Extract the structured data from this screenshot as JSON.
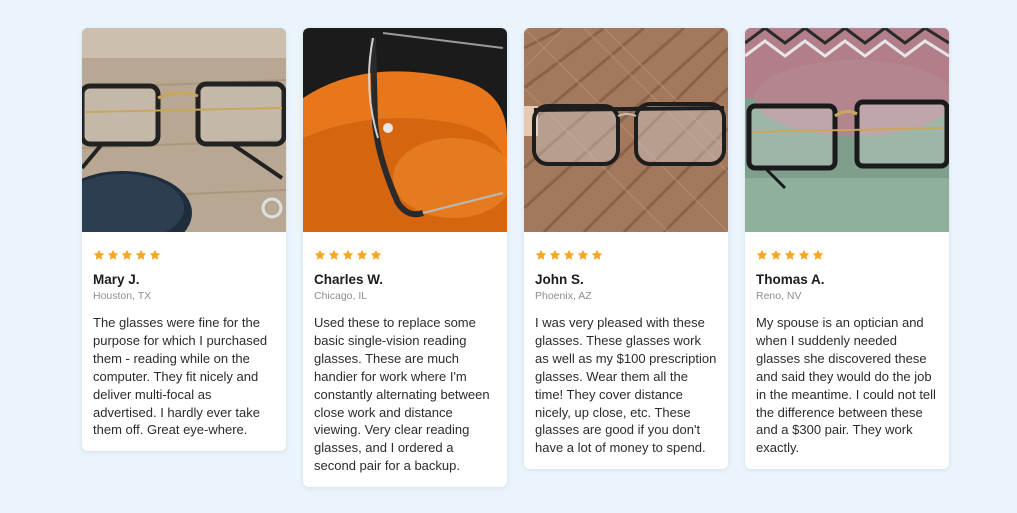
{
  "colors": {
    "background": "#eaf4fb",
    "star": "#f5a623",
    "name": "#1c1c1c",
    "location": "#8e8e8e"
  },
  "reviews": [
    {
      "photo_icon": "glasses-on-wooden-desk-photo",
      "rating": 5,
      "name": "Mary J.",
      "location": "Houston, TX",
      "text": "The glasses were fine for the purpose for which I purchased them - reading while on the computer. They fit nicely and deliver multi-focal as advertised. I hardly ever take them off. Great eye-where."
    },
    {
      "photo_icon": "glasses-on-orange-cushion-photo",
      "rating": 5,
      "name": "Charles W.",
      "location": "Chicago, IL",
      "text": "Used these to replace some basic single-vision reading glasses. These are much handier for work where I'm constantly alternating between close work and distance viewing. Very clear reading glasses, and I ordered a second pair for a backup."
    },
    {
      "photo_icon": "glasses-held-over-tile-floor-photo",
      "rating": 5,
      "name": "John S.",
      "location": "Phoenix, AZ",
      "text": "I was very pleased with these glasses. These glasses work as well as my $100 prescription glasses. Wear them all the time! They cover distance nicely, up close, etc. These glasses are good if you don't have a lot of money to spend."
    },
    {
      "photo_icon": "glasses-on-green-fabric-photo",
      "rating": 5,
      "name": "Thomas A.",
      "location": "Reno, NV",
      "text": "My spouse is an optician and when I suddenly needed glasses she discovered these and said they would do the job in the meantime. I could not tell the difference between these and a $300 pair. They work exactly."
    }
  ]
}
